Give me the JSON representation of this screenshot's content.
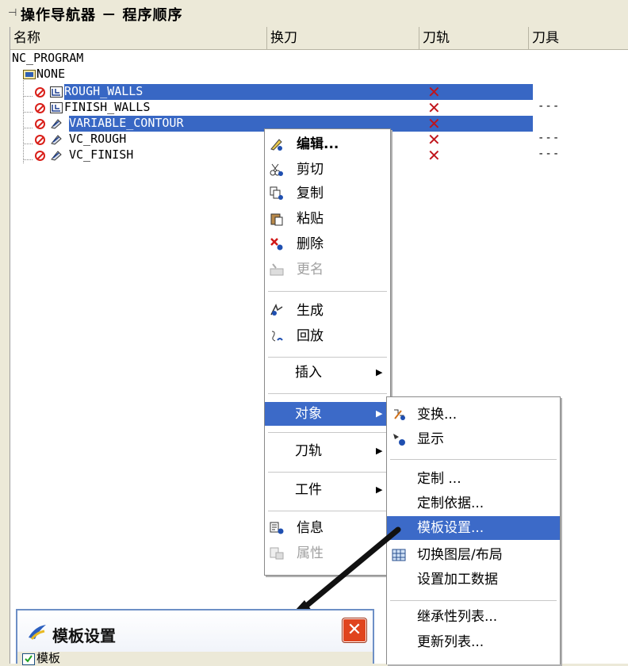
{
  "window": {
    "title": "操作导航器 － 程序顺序"
  },
  "columns": [
    "名称",
    "换刀",
    "刀轨",
    "刀具"
  ],
  "tree": {
    "root": "NC_PROGRAM",
    "group": "NONE",
    "operations": [
      {
        "name": "ROUGH_WALLS",
        "path_status": "✕",
        "tool": "---",
        "selected": true
      },
      {
        "name": "FINISH_WALLS",
        "path_status": "✕",
        "tool": "---",
        "selected": false
      },
      {
        "name": "VARIABLE_CONTOUR",
        "path_status": "✕",
        "tool": "---",
        "selected": true
      },
      {
        "name": "VC_ROUGH",
        "path_status": "✕",
        "tool": "---",
        "selected": false
      },
      {
        "name": "VC_FINISH",
        "path_status": "✕",
        "tool": "---",
        "selected": false
      }
    ]
  },
  "context_menu": {
    "edit": "编辑...",
    "cut": "剪切",
    "copy": "复制",
    "paste": "粘贴",
    "delete": "删除",
    "rename": "更名",
    "generate": "生成",
    "replay": "回放",
    "insert": "插入",
    "object": "对象",
    "toolpath": "刀轨",
    "workpiece": "工件",
    "info": "信息",
    "properties": "属性"
  },
  "submenu": {
    "transform": "变换...",
    "display": "显示",
    "customize": "定制 ...",
    "customize_basis": "定制依据...",
    "template_setup": "模板设置...",
    "toggle_layer": "切换图层/布局",
    "set_machining_data": "设置加工数据",
    "inheritance_list": "继承性列表...",
    "update_list": "更新列表..."
  },
  "dialog": {
    "title": "模板设置",
    "checkbox_label": "模板"
  },
  "colors": {
    "selection": "#3867c4",
    "menu_highlight": "#3c6ac8",
    "error_x": "#c0141b"
  }
}
